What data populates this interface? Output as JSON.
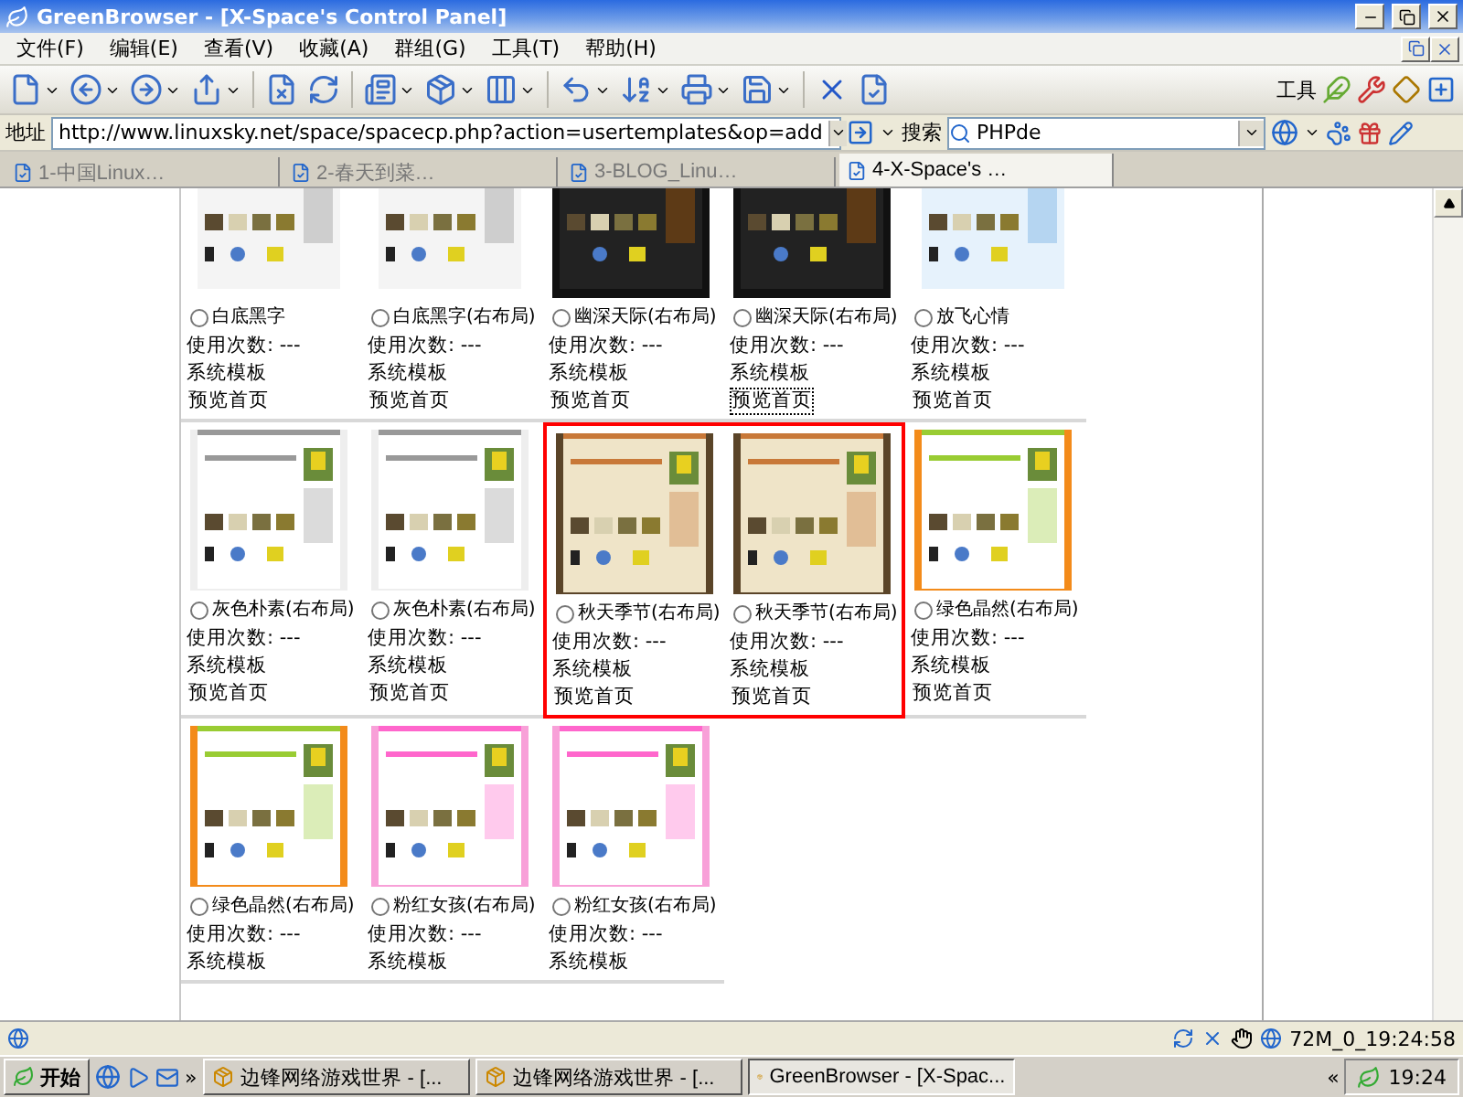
{
  "window": {
    "title": "GreenBrowser - [X-Space's Control Panel]"
  },
  "menu": [
    "文件(F)",
    "编辑(E)",
    "查看(V)",
    "收藏(A)",
    "群组(G)",
    "工具(T)",
    "帮助(H)"
  ],
  "toolbar_label": "工具",
  "address": {
    "label": "地址",
    "url": "http://www.linuxsky.net/space/spacecp.php?action=usertemplates&op=add"
  },
  "search": {
    "label": "搜索",
    "value": "PHPde"
  },
  "tabs": [
    {
      "label": "1-中国Linux…",
      "selected": false
    },
    {
      "label": "2-春天到菜…",
      "selected": false
    },
    {
      "label": "3-BLOG_Linu…",
      "selected": false
    },
    {
      "label": "4-X-Space's …",
      "selected": true
    }
  ],
  "rows": [
    {
      "cells": [
        {
          "name": "白底黑字",
          "usage": "使用次数: ---",
          "type": "系统模板",
          "preview": "预览首页",
          "selected": false,
          "highlighted": false,
          "focused": false
        },
        {
          "name": "白底黑字(右布局)",
          "usage": "使用次数: ---",
          "type": "系统模板",
          "preview": "预览首页",
          "selected": false,
          "highlighted": false,
          "focused": false
        },
        {
          "name": "幽深天际(右布局)",
          "usage": "使用次数: ---",
          "type": "系统模板",
          "preview": "预览首页",
          "selected": false,
          "highlighted": false,
          "focused": false
        },
        {
          "name": "幽深天际(右布局)",
          "usage": "使用次数: ---",
          "type": "系统模板",
          "preview": "预览首页",
          "selected": false,
          "highlighted": false,
          "focused": true
        },
        {
          "name": "放飞心情",
          "usage": "使用次数: ---",
          "type": "系统模板",
          "preview": "预览首页",
          "selected": false,
          "highlighted": false,
          "focused": false
        }
      ]
    },
    {
      "cells": [
        {
          "name": "灰色朴素(右布局)",
          "usage": "使用次数: ---",
          "type": "系统模板",
          "preview": "预览首页",
          "selected": false,
          "highlighted": false,
          "focused": false
        },
        {
          "name": "灰色朴素(右布局)",
          "usage": "使用次数: ---",
          "type": "系统模板",
          "preview": "预览首页",
          "selected": false,
          "highlighted": false,
          "focused": false
        },
        {
          "name": "秋天季节(右布局)",
          "usage": "使用次数: ---",
          "type": "系统模板",
          "preview": "预览首页",
          "selected": false,
          "highlighted": true,
          "focused": false
        },
        {
          "name": "秋天季节(右布局)",
          "usage": "使用次数: ---",
          "type": "系统模板",
          "preview": "预览首页",
          "selected": false,
          "highlighted": true,
          "focused": false
        },
        {
          "name": "绿色晶然(右布局)",
          "usage": "使用次数: ---",
          "type": "系统模板",
          "preview": "预览首页",
          "selected": false,
          "highlighted": false,
          "focused": false
        }
      ]
    },
    {
      "cells": [
        {
          "name": "绿色晶然(右布局)",
          "usage": "使用次数: ---",
          "type": "系统模板",
          "selected": false,
          "highlighted": false
        },
        {
          "name": "粉红女孩(右布局)",
          "usage": "使用次数: ---",
          "type": "系统模板",
          "selected": false,
          "highlighted": false
        },
        {
          "name": "粉红女孩(右布局)",
          "usage": "使用次数: ---",
          "type": "系统模板",
          "selected": false,
          "highlighted": false
        }
      ]
    }
  ],
  "status_bar": {
    "text": "72M_0_19:24:58"
  },
  "taskbar": {
    "start": "开始",
    "more": "»",
    "buttons": [
      {
        "label": "边锋网络游戏世界 - [...",
        "selected": false
      },
      {
        "label": "边锋网络游戏世界 - [...",
        "selected": false
      },
      {
        "label": "GreenBrowser - [X-Spac...",
        "selected": true
      }
    ],
    "tray_more": "«",
    "clock": "19:24"
  }
}
